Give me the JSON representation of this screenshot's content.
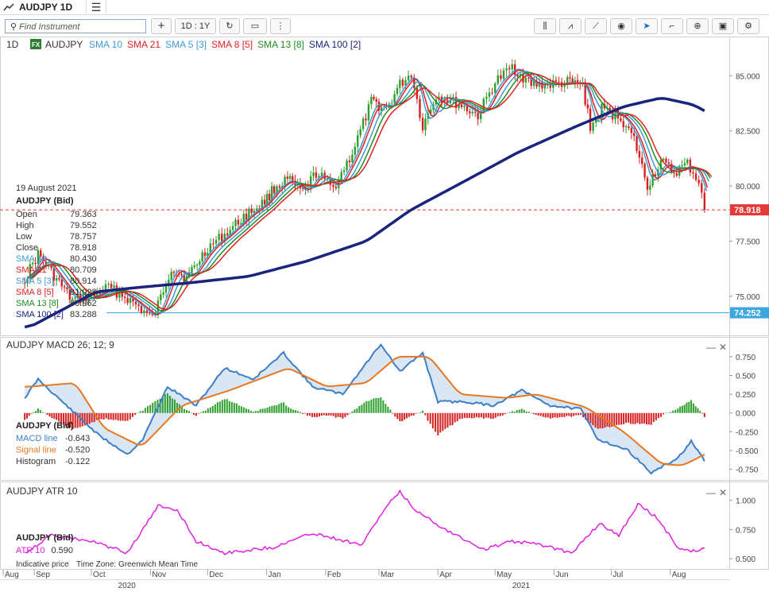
{
  "window": {
    "title": "AUDJPY 1D",
    "menu_glyph": "☰"
  },
  "toolbar": {
    "search_placeholder": "Find Instrument",
    "add_label": "+",
    "period_label": "1D : 1Y",
    "right_tools": [
      "candle-type-icon",
      "indicator-icon",
      "draw-line-icon",
      "eye-icon",
      "cursor-icon",
      "trend-tool-icon",
      "zoom-icon",
      "camera-icon",
      "settings-icon"
    ]
  },
  "legend": {
    "interval": "1D",
    "fx_badge": "FX",
    "instrument": "AUDJPY",
    "items": [
      {
        "label": "SMA 10",
        "color": "#3d9bd7"
      },
      {
        "label": "SMA 21",
        "color": "#e02020"
      },
      {
        "label": "SMA 5 [3]",
        "color": "#3d9bd7"
      },
      {
        "label": "SMA 8 [5]",
        "color": "#e02020"
      },
      {
        "label": "SMA 13 [8]",
        "color": "#1e8c1e"
      },
      {
        "label": "SMA 100 [2]",
        "color": "#1a237e"
      }
    ]
  },
  "ohlc": {
    "date": "19 August 2021",
    "title": "AUDJPY (Bid)",
    "rows": [
      {
        "label": "Open",
        "value": "79.363",
        "color": "#333333"
      },
      {
        "label": "High",
        "value": "79.552",
        "color": "#333333"
      },
      {
        "label": "Low",
        "value": "78.757",
        "color": "#333333"
      },
      {
        "label": "Close",
        "value": "78.918",
        "color": "#333333"
      },
      {
        "label": "SMA 10",
        "value": "80.430",
        "color": "#3d9bd7"
      },
      {
        "label": "SMA 21",
        "value": "80.709",
        "color": "#e02020"
      },
      {
        "label": "SMA 5 [3]",
        "value": "80.914",
        "color": "#3d9bd7"
      },
      {
        "label": "SMA 8 [5]",
        "value": "81.028",
        "color": "#e02020"
      },
      {
        "label": "SMA 13 [8]",
        "value": "80.962",
        "color": "#1e8c1e"
      },
      {
        "label": "SMA 100 [2]",
        "value": "83.288",
        "color": "#1a237e"
      }
    ]
  },
  "macd": {
    "title": "AUDJPY  MACD 26; 12; 9",
    "box_title": "AUDJPY (Bid)",
    "rows": [
      {
        "label": "MACD line",
        "value": "-0.643",
        "color": "#3d7fc4"
      },
      {
        "label": "Signal line",
        "value": "-0.520",
        "color": "#e87722"
      },
      {
        "label": "Histogram",
        "value": "-0.122",
        "color": "#333333"
      }
    ],
    "ticks": [
      "0.750",
      "0.500",
      "0.250",
      "0.000",
      "-0.250",
      "-0.500",
      "-0.750"
    ]
  },
  "atr": {
    "title": "AUDJPY  ATR 10",
    "box_title": "AUDJPY (Bid)",
    "row": {
      "label": "ATR 10",
      "value": "0.590",
      "color": "#e020e0"
    },
    "ticks": [
      "1.000",
      "0.750",
      "0.500"
    ]
  },
  "price_axis": {
    "ticks": [
      "85.000",
      "82.500",
      "80.000",
      "77.500",
      "75.000"
    ],
    "last_price_label": "78.918",
    "last_price_color": "#e53935",
    "hline_label": "74.252",
    "hline_color": "#3da5e0"
  },
  "footer": {
    "indicative": "Indicative price",
    "timezone": "Time Zone: Greenwich Mean Time"
  },
  "x_axis": {
    "months": [
      "Aug",
      "Sep",
      "Oct",
      "Nov",
      "Dec",
      "Jan",
      "Feb",
      "Mar",
      "Apr",
      "May",
      "Jun",
      "Jul",
      "Aug"
    ],
    "years": [
      "2020",
      "2021"
    ]
  },
  "controls": {
    "minimize": "—",
    "close": "✕"
  },
  "chart_data": [
    {
      "type": "candlestick",
      "title": "AUDJPY 1D",
      "price_range": [
        73.3,
        86.2
      ],
      "last_close": 78.918,
      "horizontal_line": 74.252,
      "period_start": "2020-08-27",
      "period_end": "2021-08-19",
      "close_path": [
        [
          "2020-08-27",
          75.8
        ],
        [
          "2020-09-03",
          76.9
        ],
        [
          "2020-09-21",
          74.8
        ],
        [
          "2020-10-01",
          75.0
        ],
        [
          "2020-10-10",
          75.4
        ],
        [
          "2020-10-20",
          74.9
        ],
        [
          "2020-11-02",
          74.0
        ],
        [
          "2020-11-05",
          74.6
        ],
        [
          "2020-11-12",
          76.3
        ],
        [
          "2020-11-20",
          75.8
        ],
        [
          "2020-12-01",
          77.2
        ],
        [
          "2020-12-10",
          77.8
        ],
        [
          "2020-12-20",
          78.6
        ],
        [
          "2020-12-31",
          79.3
        ],
        [
          "2021-01-05",
          79.9
        ],
        [
          "2021-01-12",
          80.3
        ],
        [
          "2021-01-20",
          79.7
        ],
        [
          "2021-01-27",
          80.6
        ],
        [
          "2021-02-05",
          79.9
        ],
        [
          "2021-02-15",
          81.5
        ],
        [
          "2021-02-25",
          83.8
        ],
        [
          "2021-03-05",
          83.5
        ],
        [
          "2021-03-12",
          84.6
        ],
        [
          "2021-03-18",
          85.1
        ],
        [
          "2021-03-24",
          82.7
        ],
        [
          "2021-03-31",
          84.1
        ],
        [
          "2021-04-12",
          83.7
        ],
        [
          "2021-04-22",
          83.2
        ],
        [
          "2021-05-01",
          84.7
        ],
        [
          "2021-05-10",
          85.4
        ],
        [
          "2021-05-20",
          84.6
        ],
        [
          "2021-05-30",
          84.6
        ],
        [
          "2021-06-08",
          84.7
        ],
        [
          "2021-06-16",
          84.6
        ],
        [
          "2021-06-20",
          82.6
        ],
        [
          "2021-06-26",
          83.5
        ],
        [
          "2021-07-06",
          83.1
        ],
        [
          "2021-07-13",
          82.1
        ],
        [
          "2021-07-20",
          80.0
        ],
        [
          "2021-07-27",
          81.1
        ],
        [
          "2021-08-03",
          80.6
        ],
        [
          "2021-08-10",
          81.0
        ],
        [
          "2021-08-16",
          80.2
        ],
        [
          "2021-08-19",
          78.918
        ]
      ],
      "sma100_path": [
        [
          "2020-08-27",
          73.6
        ],
        [
          "2020-10-01",
          75.2
        ],
        [
          "2020-10-23",
          75.4
        ],
        [
          "2020-11-18",
          75.6
        ],
        [
          "2020-12-20",
          75.9
        ],
        [
          "2021-01-20",
          76.6
        ],
        [
          "2021-02-20",
          77.5
        ],
        [
          "2021-03-15",
          78.9
        ],
        [
          "2021-04-10",
          80.1
        ],
        [
          "2021-05-10",
          81.5
        ],
        [
          "2021-06-10",
          82.7
        ],
        [
          "2021-07-05",
          83.6
        ],
        [
          "2021-07-25",
          84.0
        ],
        [
          "2021-08-10",
          83.7
        ],
        [
          "2021-08-19",
          83.288
        ]
      ]
    },
    {
      "type": "line",
      "title": "AUDJPY  MACD 26; 12; 9",
      "ylim": [
        -0.8,
        0.9
      ],
      "series": [
        {
          "name": "MACD line",
          "points": [
            [
              "2020-08-27",
              0.2
            ],
            [
              "2020-09-03",
              0.45
            ],
            [
              "2020-09-20",
              0.05
            ],
            [
              "2020-10-05",
              -0.3
            ],
            [
              "2020-10-20",
              -0.55
            ],
            [
              "2020-10-28",
              -0.35
            ],
            [
              "2020-11-10",
              0.35
            ],
            [
              "2020-11-25",
              0.1
            ],
            [
              "2020-12-10",
              0.6
            ],
            [
              "2020-12-25",
              0.45
            ],
            [
              "2021-01-10",
              0.8
            ],
            [
              "2021-01-25",
              0.35
            ],
            [
              "2021-02-10",
              0.25
            ],
            [
              "2021-03-02",
              0.92
            ],
            [
              "2021-03-12",
              0.55
            ],
            [
              "2021-03-24",
              0.8
            ],
            [
              "2021-04-01",
              0.15
            ],
            [
              "2021-04-15",
              0.15
            ],
            [
              "2021-04-30",
              0.1
            ],
            [
              "2021-05-15",
              0.3
            ],
            [
              "2021-05-30",
              0.1
            ],
            [
              "2021-06-15",
              0.05
            ],
            [
              "2021-06-24",
              -0.35
            ],
            [
              "2021-07-10",
              -0.5
            ],
            [
              "2021-07-22",
              -0.8
            ],
            [
              "2021-08-05",
              -0.6
            ],
            [
              "2021-08-12",
              -0.38
            ],
            [
              "2021-08-19",
              -0.643
            ]
          ]
        },
        {
          "name": "Signal line",
          "points": [
            [
              "2020-08-27",
              0.35
            ],
            [
              "2020-09-20",
              0.4
            ],
            [
              "2020-10-05",
              -0.2
            ],
            [
              "2020-10-25",
              -0.45
            ],
            [
              "2020-11-15",
              0.1
            ],
            [
              "2020-12-10",
              0.3
            ],
            [
              "2021-01-10",
              0.6
            ],
            [
              "2021-01-30",
              0.35
            ],
            [
              "2021-02-20",
              0.4
            ],
            [
              "2021-03-08",
              0.75
            ],
            [
              "2021-03-25",
              0.75
            ],
            [
              "2021-04-10",
              0.25
            ],
            [
              "2021-05-05",
              0.2
            ],
            [
              "2021-05-20",
              0.25
            ],
            [
              "2021-06-15",
              0.08
            ],
            [
              "2021-07-05",
              -0.25
            ],
            [
              "2021-07-25",
              -0.68
            ],
            [
              "2021-08-05",
              -0.7
            ],
            [
              "2021-08-19",
              -0.52
            ]
          ]
        }
      ]
    },
    {
      "type": "line",
      "title": "AUDJPY  ATR 10",
      "ylim": [
        0.45,
        1.1
      ],
      "series": [
        {
          "name": "ATR 10",
          "points": [
            [
              "2020-08-27",
              0.55
            ],
            [
              "2020-09-10",
              0.7
            ],
            [
              "2020-10-01",
              0.65
            ],
            [
              "2020-10-20",
              0.55
            ],
            [
              "2020-11-05",
              0.95
            ],
            [
              "2020-11-15",
              0.92
            ],
            [
              "2020-11-25",
              0.65
            ],
            [
              "2020-12-10",
              0.55
            ],
            [
              "2021-01-05",
              0.6
            ],
            [
              "2021-01-25",
              0.72
            ],
            [
              "2021-02-20",
              0.62
            ],
            [
              "2021-03-05",
              0.95
            ],
            [
              "2021-03-12",
              1.07
            ],
            [
              "2021-03-20",
              0.92
            ],
            [
              "2021-04-05",
              0.75
            ],
            [
              "2021-04-25",
              0.58
            ],
            [
              "2021-05-10",
              0.65
            ],
            [
              "2021-05-25",
              0.62
            ],
            [
              "2021-06-10",
              0.55
            ],
            [
              "2021-06-25",
              0.8
            ],
            [
              "2021-07-05",
              0.7
            ],
            [
              "2021-07-15",
              0.97
            ],
            [
              "2021-07-25",
              0.85
            ],
            [
              "2021-08-05",
              0.6
            ],
            [
              "2021-08-12",
              0.56
            ],
            [
              "2021-08-19",
              0.59
            ]
          ]
        }
      ]
    }
  ]
}
